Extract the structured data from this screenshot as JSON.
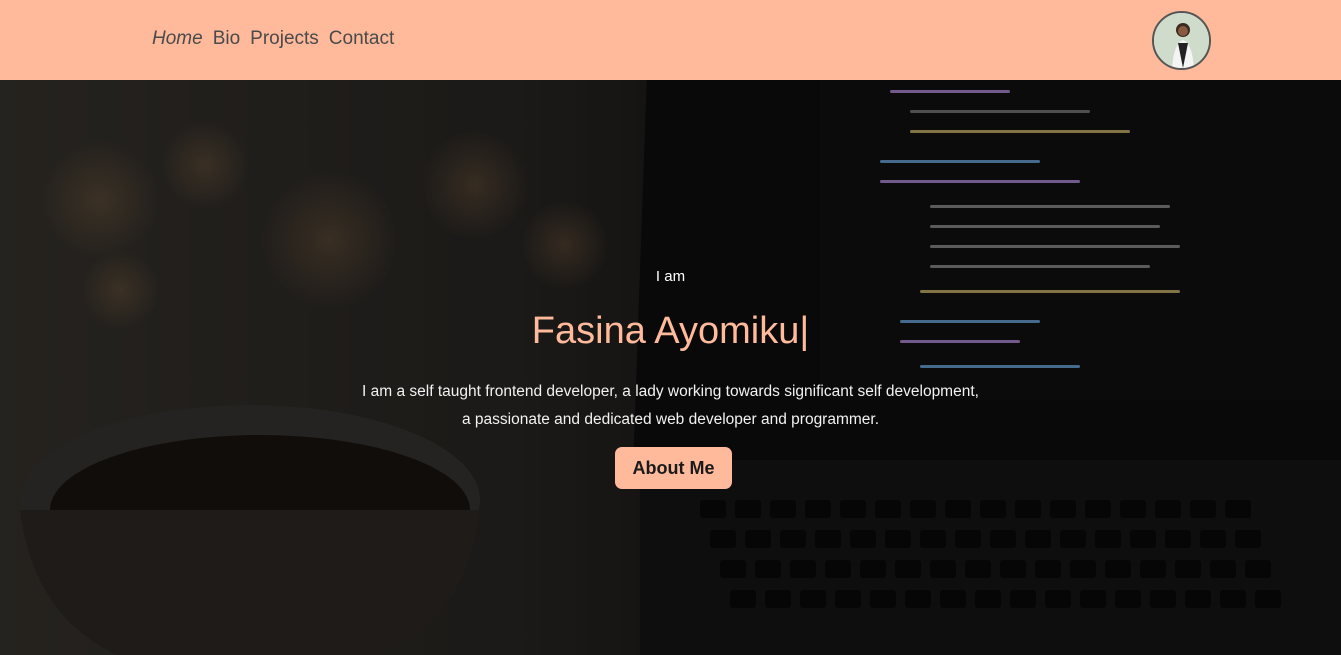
{
  "nav": {
    "links": [
      "Home",
      "Bio",
      "Projects",
      "Contact"
    ],
    "active_link": "Home"
  },
  "hero": {
    "intro": "I am",
    "name": "Fasina Ayomiku",
    "cursor": "|",
    "description_line1": "I am a self taught frontend developer, a lady working towards significant self development,",
    "description_line2": "a passionate and dedicated web developer and programmer.",
    "cta_label": "About Me"
  },
  "colors": {
    "accent": "#ffba9b",
    "nav_text": "#4a4a4a"
  },
  "icons": {
    "profile": "avatar-photo"
  }
}
